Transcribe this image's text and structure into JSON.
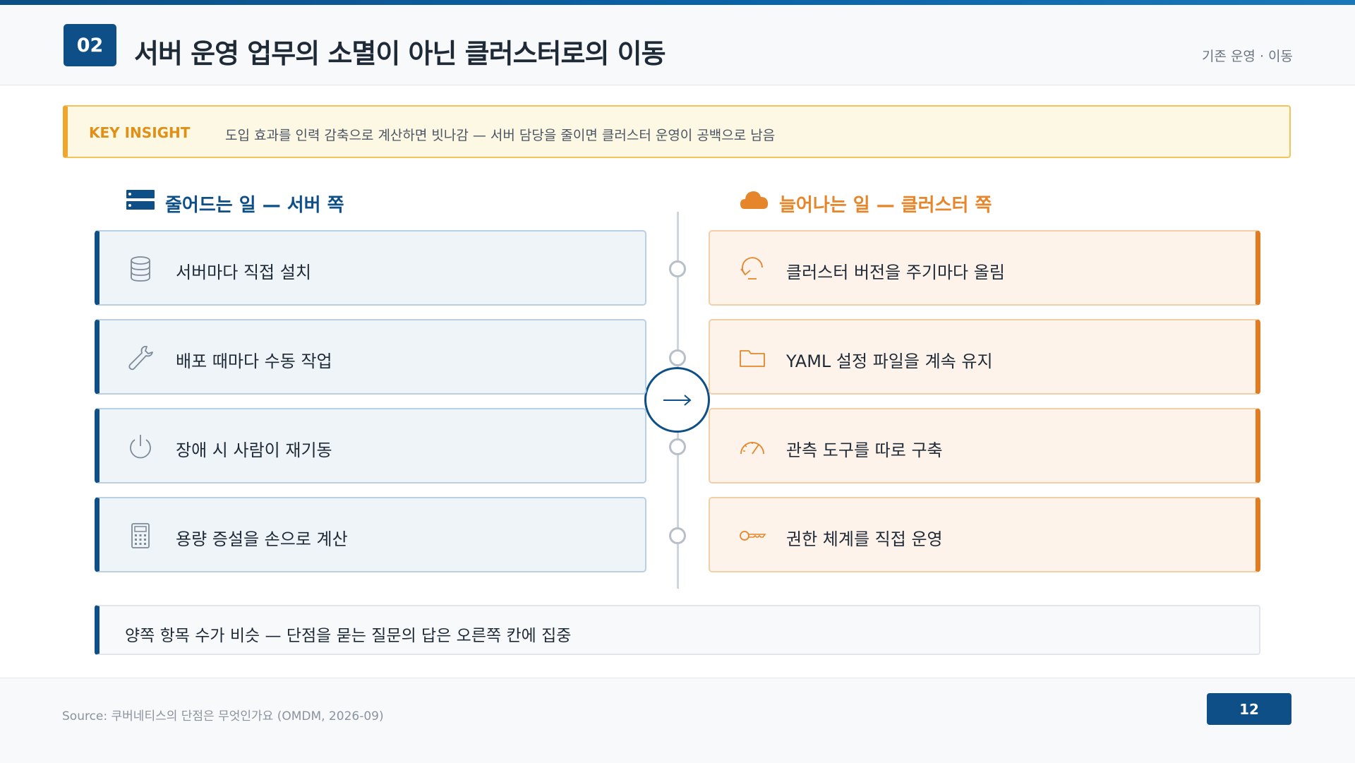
{
  "header": {
    "badge": "02",
    "title": "서버 운영 업무의 소멸이 아닌 클러스터로의 이동",
    "section": "기존 운영 · 이동"
  },
  "insight": {
    "label": "KEY INSIGHT",
    "text": "도입 효과를 인력 감축으로 계산하면 빗나감 — 서버 담당을 줄이면 클러스터 운영이 공백으로 남음"
  },
  "left": {
    "title": "줄어드는 일 — 서버 쪽",
    "title_icon": "server-icon",
    "items": [
      {
        "label": "서버마다 직접 설치",
        "icon": "database-icon"
      },
      {
        "label": "배포 때마다 수동 작업",
        "icon": "wrench-icon"
      },
      {
        "label": "장애 시 사람이 재기동",
        "icon": "power-icon"
      },
      {
        "label": "용량 증설을 손으로 계산",
        "icon": "calculator-icon"
      }
    ]
  },
  "right": {
    "title": "늘어나는 일 — 클러스터 쪽",
    "title_icon": "cloud-icon",
    "items": [
      {
        "label": "클러스터 버전을 주기마다 올림",
        "icon": "refresh-icon"
      },
      {
        "label": "YAML 설정 파일을 계속 유지",
        "icon": "folder-icon"
      },
      {
        "label": "관측 도구를 따로 구축",
        "icon": "gauge-icon"
      },
      {
        "label": "권한 체계를 직접 운영",
        "icon": "key-icon"
      }
    ]
  },
  "center_icon": "arrow-right-icon",
  "summary": "양쪽 항목 수가 비슷 — 단점을 묻는 질문의 답은 오른쪽 칸에 집중",
  "footer": {
    "source": "Source: 쿠버네티스의 단점은 무엇인가요 (OMDM, 2026-09)",
    "page": "12"
  },
  "colors": {
    "primary": "#0d4f86",
    "accent": "#e07b20",
    "insight_bg": "#fdf8e4"
  }
}
